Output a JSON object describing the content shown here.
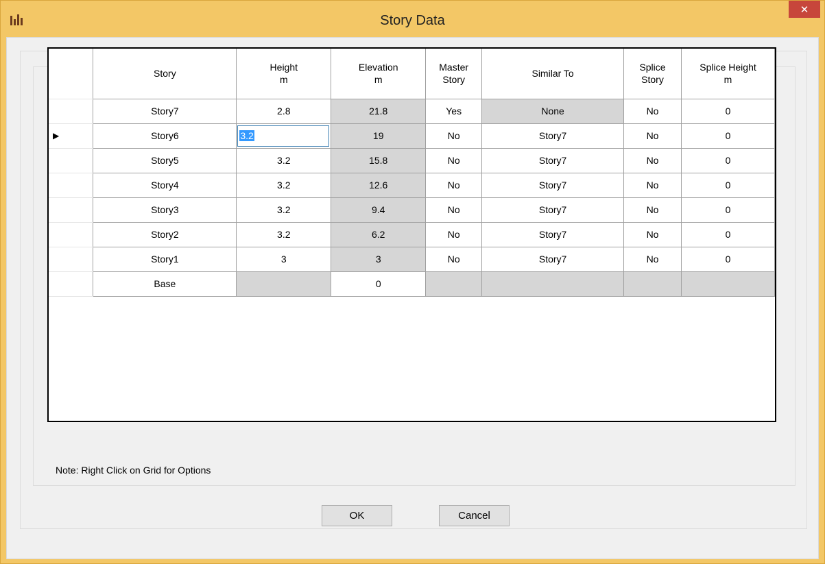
{
  "window": {
    "title": "Story Data",
    "close_label": "✕"
  },
  "grid": {
    "columns": [
      {
        "label": "Story",
        "unit": ""
      },
      {
        "label": "Height",
        "unit": "m"
      },
      {
        "label": "Elevation",
        "unit": "m"
      },
      {
        "label": "Master",
        "unit": "Story"
      },
      {
        "label": "Similar To",
        "unit": ""
      },
      {
        "label": "Splice",
        "unit": "Story"
      },
      {
        "label": "Splice Height",
        "unit": "m"
      }
    ],
    "current_row_marker": "▶",
    "rows": [
      {
        "story": "Story7",
        "height": "2.8",
        "elevation": "21.8",
        "master": "Yes",
        "similar": "None",
        "splice": "No",
        "splice_height": "0"
      },
      {
        "story": "Story6",
        "height": "3.2",
        "elevation": "19",
        "master": "No",
        "similar": "Story7",
        "splice": "No",
        "splice_height": "0"
      },
      {
        "story": "Story5",
        "height": "3.2",
        "elevation": "15.8",
        "master": "No",
        "similar": "Story7",
        "splice": "No",
        "splice_height": "0"
      },
      {
        "story": "Story4",
        "height": "3.2",
        "elevation": "12.6",
        "master": "No",
        "similar": "Story7",
        "splice": "No",
        "splice_height": "0"
      },
      {
        "story": "Story3",
        "height": "3.2",
        "elevation": "9.4",
        "master": "No",
        "similar": "Story7",
        "splice": "No",
        "splice_height": "0"
      },
      {
        "story": "Story2",
        "height": "3.2",
        "elevation": "6.2",
        "master": "No",
        "similar": "Story7",
        "splice": "No",
        "splice_height": "0"
      },
      {
        "story": "Story1",
        "height": "3",
        "elevation": "3",
        "master": "No",
        "similar": "Story7",
        "splice": "No",
        "splice_height": "0"
      },
      {
        "story": "Base",
        "height": "",
        "elevation": "0",
        "master": "",
        "similar": "",
        "splice": "",
        "splice_height": ""
      }
    ]
  },
  "note": "Note:  Right Click on Grid for Options",
  "buttons": {
    "ok": "OK",
    "cancel": "Cancel"
  }
}
